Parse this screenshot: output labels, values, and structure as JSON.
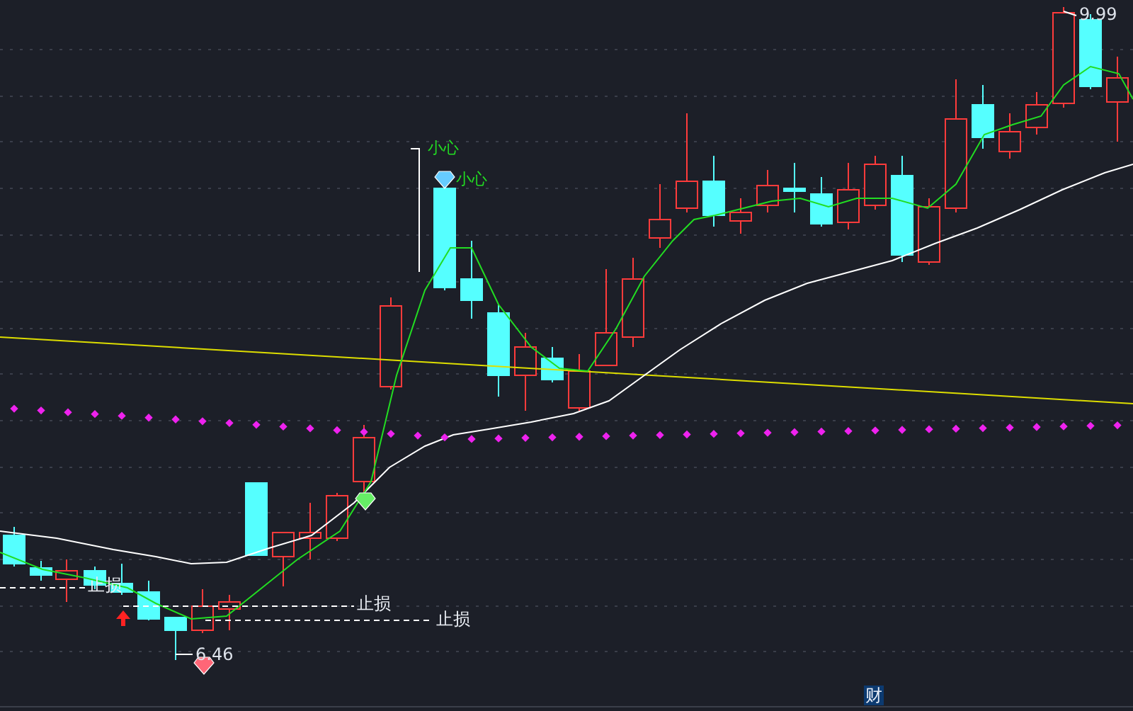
{
  "chart": {
    "labels": [
      {
        "kind": "price",
        "text": "9.99"
      },
      {
        "kind": "caution",
        "text": "小心"
      },
      {
        "kind": "caution",
        "text": "小心"
      },
      {
        "kind": "stop",
        "text": "止损"
      },
      {
        "kind": "stop",
        "text": "止损"
      },
      {
        "kind": "stop",
        "text": "止损"
      },
      {
        "kind": "price",
        "text": "6.46"
      }
    ]
  },
  "footer": {
    "marker": "财"
  }
}
